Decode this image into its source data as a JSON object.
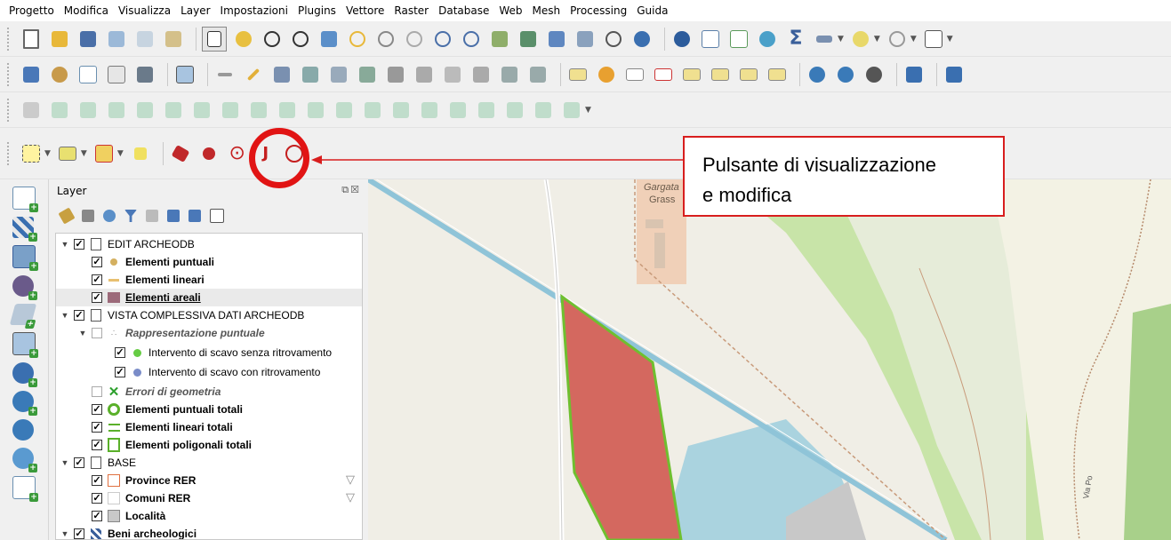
{
  "menubar": {
    "items": [
      "Progetto",
      "Modifica",
      "Visualizza",
      "Layer",
      "Impostazioni",
      "Plugins",
      "Vettore",
      "Raster",
      "Database",
      "Web",
      "Mesh",
      "Processing",
      "Guida"
    ]
  },
  "layers_panel": {
    "title": "Layer",
    "header_buttons": "⧉☒",
    "tree": [
      {
        "label": "EDIT ARCHEODB",
        "type": "group",
        "checked": true
      },
      {
        "label": "Elementi puntuali",
        "checked": true
      },
      {
        "label": "Elementi lineari",
        "checked": true
      },
      {
        "label": "Elementi areali",
        "checked": true,
        "selected": true
      },
      {
        "label": "VISTA COMPLESSIVA DATI ARCHEODB",
        "type": "group",
        "checked": true
      },
      {
        "label": "Rappresentazione puntuale",
        "checked": false
      },
      {
        "label": "Intervento di scavo senza ritrovamento",
        "checked": true
      },
      {
        "label": "Intervento di scavo con ritrovamento",
        "checked": true
      },
      {
        "label": "Errori di geometria",
        "checked": false
      },
      {
        "label": "Elementi puntuali totali",
        "checked": true
      },
      {
        "label": "Elementi lineari totali",
        "checked": true
      },
      {
        "label": "Elementi poligonali totali",
        "checked": true
      },
      {
        "label": "BASE",
        "type": "group",
        "checked": true
      },
      {
        "label": "Province RER",
        "checked": true
      },
      {
        "label": "Comuni RER",
        "checked": true
      },
      {
        "label": "Località",
        "checked": true
      },
      {
        "label": "Beni archeologici",
        "type": "group",
        "checked": true
      }
    ]
  },
  "annotation": {
    "line1": "Pulsante di visualizzazione",
    "line2": "e modifica"
  },
  "map": {
    "labels": [
      "Gargata",
      "Grass",
      "Via Po"
    ]
  },
  "colors": {
    "highlight": "#e11414",
    "polygon_fill": "#d4685f",
    "polygon_stroke": "#6fbf2f",
    "water": "#aad3df",
    "green": "#c8e4a8"
  }
}
